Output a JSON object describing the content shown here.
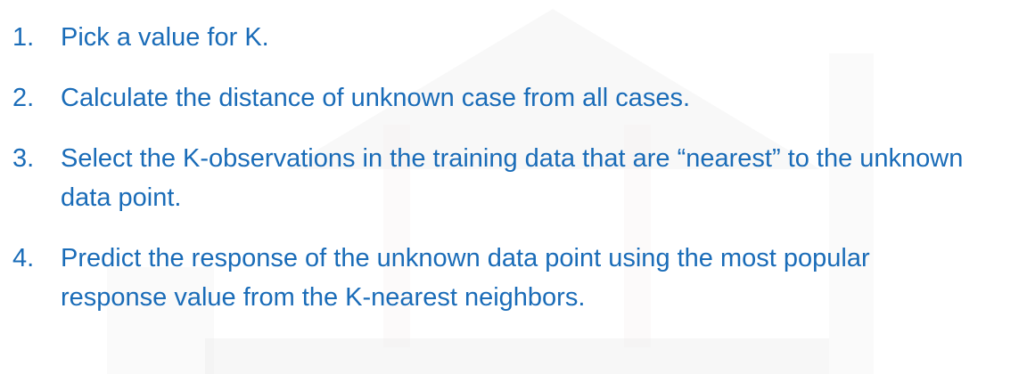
{
  "steps": [
    {
      "number": "1.",
      "text": "Pick a value for K."
    },
    {
      "number": "2.",
      "text": "Calculate the distance of unknown case from all cases."
    },
    {
      "number": "3.",
      "text": "Select the K-observations in the training data that are “nearest” to the unknown data point."
    },
    {
      "number": "4.",
      "text": "Predict the response of the unknown data point using the most popular response value from the K-nearest neighbors."
    }
  ],
  "colors": {
    "text": "#1a6cb8",
    "background": "#ffffff"
  }
}
